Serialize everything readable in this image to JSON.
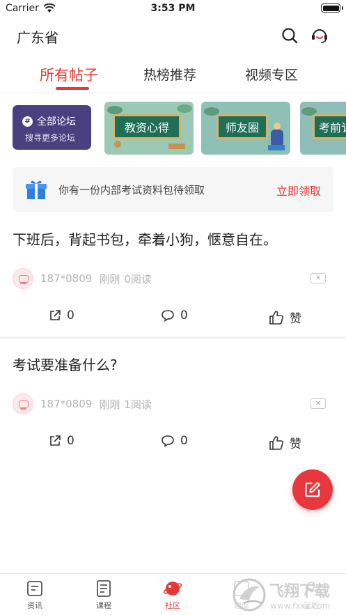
{
  "status_bar": {
    "carrier": "Carrier",
    "time": "3:53 PM"
  },
  "header": {
    "province": "广东省",
    "search_icon": "search-icon",
    "service_icon": "customer-service-icon"
  },
  "tabs": [
    {
      "label": "所有帖子",
      "active": true
    },
    {
      "label": "热榜推荐",
      "active": false
    },
    {
      "label": "视频专区",
      "active": false
    }
  ],
  "forums": {
    "all": {
      "title": "全部论坛",
      "subtitle": "搜寻更多论坛"
    },
    "cards": [
      {
        "label": "教资心得"
      },
      {
        "label": "师友圈"
      },
      {
        "label": "考前讠"
      }
    ]
  },
  "banner": {
    "text": "你有一份内部考试资料包待领取",
    "link": "立即领取",
    "icon": "gift-icon"
  },
  "posts": [
    {
      "title": "下班后，背起书包，牵着小狗，惬意自在。",
      "user": "187*0809",
      "time": "刚刚",
      "reads": "0阅读",
      "shares": "0",
      "comments": "0",
      "like_label": "赞"
    },
    {
      "title": "考试要准备什么?",
      "user": "187*0809",
      "time": "刚刚",
      "reads": "1阅读",
      "shares": "0",
      "comments": "0",
      "like_label": "赞"
    }
  ],
  "bottom_nav": [
    {
      "label": "资讯",
      "active": false
    },
    {
      "label": "课程",
      "active": false
    },
    {
      "label": "社区",
      "active": true
    },
    {
      "label": "题库",
      "active": false
    },
    {
      "label": "我的",
      "active": false
    }
  ],
  "watermark": {
    "text": "飞翔下载",
    "url": "www.fxxz.com"
  },
  "colors": {
    "accent": "#e53935",
    "forum_purple": "#4a3f7f",
    "board_green": "#1f6e55"
  }
}
